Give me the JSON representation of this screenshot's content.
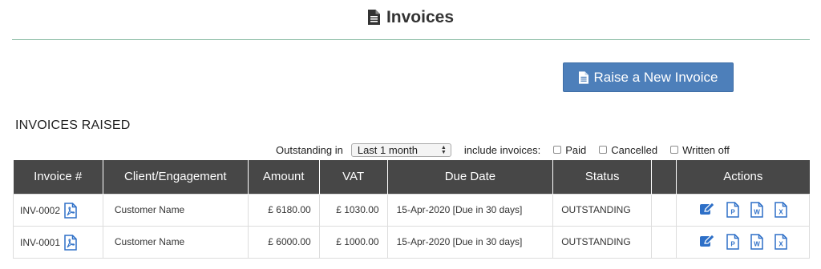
{
  "page": {
    "title": "Invoices"
  },
  "toolbar": {
    "raise_label": "Raise a New Invoice"
  },
  "section": {
    "heading": "INVOICES RAISED"
  },
  "filters": {
    "outstanding_label": "Outstanding in",
    "period_value": "Last 1 month",
    "include_label": "include invoices:",
    "checks": [
      {
        "label": "Paid",
        "checked": false
      },
      {
        "label": "Cancelled",
        "checked": false
      },
      {
        "label": "Written off",
        "checked": false
      }
    ]
  },
  "table": {
    "headers": [
      "Invoice #",
      "Client/Engagement",
      "Amount",
      "VAT",
      "Due Date",
      "Status",
      "",
      "Actions"
    ],
    "rows": [
      {
        "invoice": "INV-0002",
        "client": "Customer Name",
        "amount": "£ 6180.00",
        "vat": "£ 1030.00",
        "due": "15-Apr-2020 [Due in 30 days]",
        "status": "OUTSTANDING"
      },
      {
        "invoice": "INV-0001",
        "client": "Customer Name",
        "amount": "£ 6000.00",
        "vat": "£ 1000.00",
        "due": "15-Apr-2020 [Due in 30 days]",
        "status": "OUTSTANDING"
      }
    ]
  },
  "icons": {
    "title": "file-icon",
    "button": "file-icon",
    "invoice_pdf": "pdf-icon",
    "actions": [
      "edit-icon",
      "ppt-icon",
      "word-icon",
      "excel-icon"
    ],
    "action_letters": [
      "P",
      "W",
      "X"
    ]
  },
  "colors": {
    "accent": "#4d7fba",
    "header_bg": "#474747",
    "icon_blue": "#2d6fc7",
    "rule": "#8fbfa8"
  }
}
